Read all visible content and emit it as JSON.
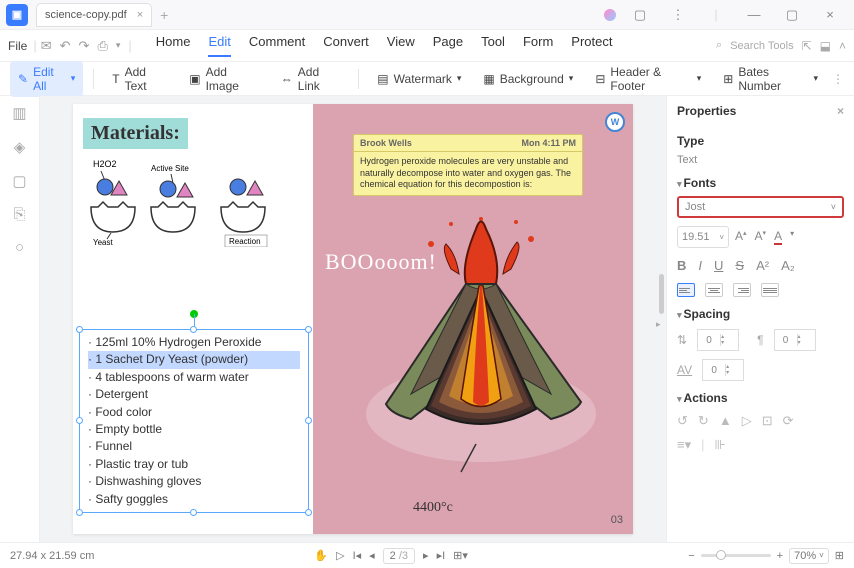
{
  "titlebar": {
    "filename": "science-copy.pdf"
  },
  "menubar": {
    "file": "File",
    "tabs": [
      "Home",
      "Edit",
      "Comment",
      "Convert",
      "View",
      "Page",
      "Tool",
      "Form",
      "Protect"
    ],
    "active": "Edit",
    "search_placeholder": "Search Tools"
  },
  "toolbar": {
    "edit_all": "Edit All",
    "add_text": "Add Text",
    "add_image": "Add Image",
    "add_link": "Add Link",
    "watermark": "Watermark",
    "background": "Background",
    "header_footer": "Header & Footer",
    "bates": "Bates Number"
  },
  "document": {
    "materials_title": "Materials:",
    "diagram_labels": {
      "h2o2": "H2O2",
      "active_site": "Active Site",
      "yeast": "Yeast",
      "reaction": "Reaction"
    },
    "list": [
      "125ml 10% Hydrogen Peroxide",
      "1 Sachet Dry Yeast (powder)",
      "4 tablespoons of warm water",
      "Detergent",
      "Food color",
      "Empty bottle",
      "Funnel",
      "Plastic tray or tub",
      "Dishwashing gloves",
      "Safty goggles"
    ],
    "selected_index": 1,
    "note": {
      "author": "Brook Wells",
      "time": "Mon 4:11 PM",
      "body": "Hydrogen peroxide molecules are very unstable and naturally decompose into water and oxygen gas. The chemical equation for this decompostion is:"
    },
    "boom": "BOOooom!",
    "temp": "4400°c",
    "pagenum": "03"
  },
  "properties": {
    "title": "Properties",
    "type_label": "Type",
    "type_value": "Text",
    "fonts_label": "Fonts",
    "font_name": "Jost",
    "font_size": "19.51",
    "spacing_label": "Spacing",
    "spacing_line": "0",
    "spacing_para": "0",
    "spacing_char": "0",
    "actions_label": "Actions"
  },
  "statusbar": {
    "coords": "27.94 x 21.59 cm",
    "page_current": "2",
    "page_total": "/3",
    "zoom": "70%"
  }
}
